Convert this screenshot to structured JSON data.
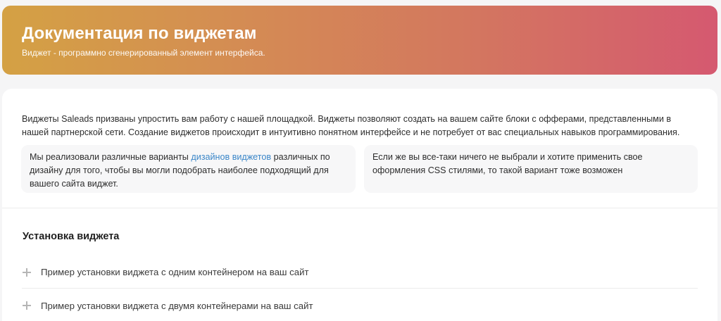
{
  "hero": {
    "title": "Документация по виджетам",
    "subtitle": "Виджет - программно сгенерированный элемент интерфейса.",
    "gradient": [
      "#d4a144",
      "#d55970"
    ]
  },
  "intro": {
    "text": "Виджеты Saleads призваны упростить вам работу с нашей площадкой. Виджеты позволяют создать на вашем сайте блоки с офферами, представленными в нашей партнерской сети. Создание виджетов происходит в интуитивно понятном интерфейсе и не потребует от вас специальных навыков программирования."
  },
  "notes": {
    "left_before": "Мы реализовали различные варианты ",
    "left_link": "дизайнов виджетов",
    "left_after": " различных по дизайну для того, чтобы вы могли подобрать наиболее подходящий для вашего сайта виджет.",
    "right": "Если же вы все-таки ничего не выбрали и хотите применить свое оформления CSS стилями, то такой вариант тоже возможен"
  },
  "install": {
    "title": "Установка виджета",
    "items": [
      {
        "label": "Пример установки виджета с одним контейнером на ваш сайт",
        "icon": "plus-icon"
      },
      {
        "label": "Пример установки виджета с двумя контейнерами на ваш сайт",
        "icon": "plus-icon"
      }
    ]
  },
  "colors": {
    "link": "#3a86c8",
    "note_bg": "#f7f7f8"
  }
}
